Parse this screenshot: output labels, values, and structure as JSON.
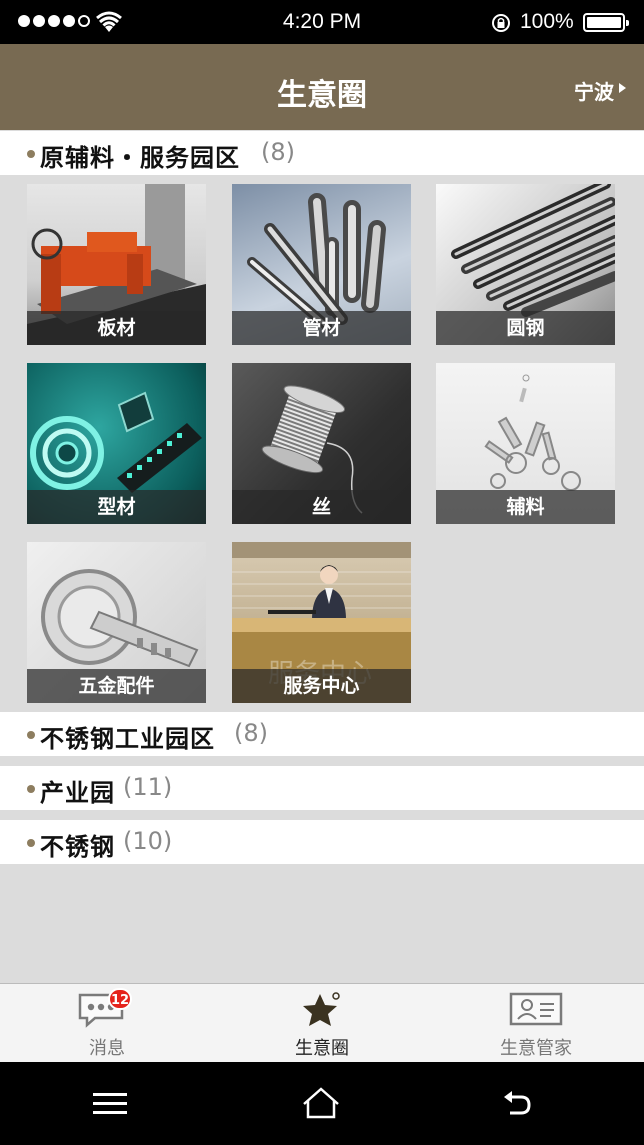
{
  "status_bar": {
    "time": "4:20 PM",
    "battery_percent": "100%",
    "signal_bars_filled": 4,
    "signal_bars_total": 5
  },
  "header": {
    "title": "生意圈",
    "city": "宁波"
  },
  "sections": [
    {
      "title": "原辅料・服务园区",
      "count": "(8)",
      "expanded": true
    },
    {
      "title": "不锈钢工业园区",
      "count": "(8)",
      "expanded": false
    },
    {
      "title": "产业园",
      "count": "(11)",
      "expanded": false
    },
    {
      "title": "不锈钢",
      "count": "(10)",
      "expanded": false
    }
  ],
  "tiles": [
    {
      "label": "板材",
      "icon": "plate-cutting-machine-image"
    },
    {
      "label": "管材",
      "icon": "steel-pipes-image"
    },
    {
      "label": "圆钢",
      "icon": "round-steel-bars-image"
    },
    {
      "label": "型材",
      "icon": "wire-spool-profile-image"
    },
    {
      "label": "丝",
      "icon": "wire-spool-image"
    },
    {
      "label": "辅料",
      "icon": "fasteners-image"
    },
    {
      "label": "五金配件",
      "icon": "hardware-key-image"
    },
    {
      "label": "服务中心",
      "icon": "service-desk-image"
    }
  ],
  "tile_watermark": "服务中心",
  "tab_bar": {
    "tabs": [
      {
        "label": "消息",
        "icon": "message-icon",
        "badge": "12",
        "active": false
      },
      {
        "label": "生意圈",
        "icon": "star-icon",
        "active": true
      },
      {
        "label": "生意管家",
        "icon": "business-card-icon",
        "active": false
      }
    ]
  },
  "system_nav": {
    "buttons": [
      "menu-icon",
      "home-icon",
      "back-icon"
    ]
  },
  "colors": {
    "header_bg": "#786a52",
    "accent_bullet": "#8d7d5f",
    "badge": "#e5231b"
  }
}
